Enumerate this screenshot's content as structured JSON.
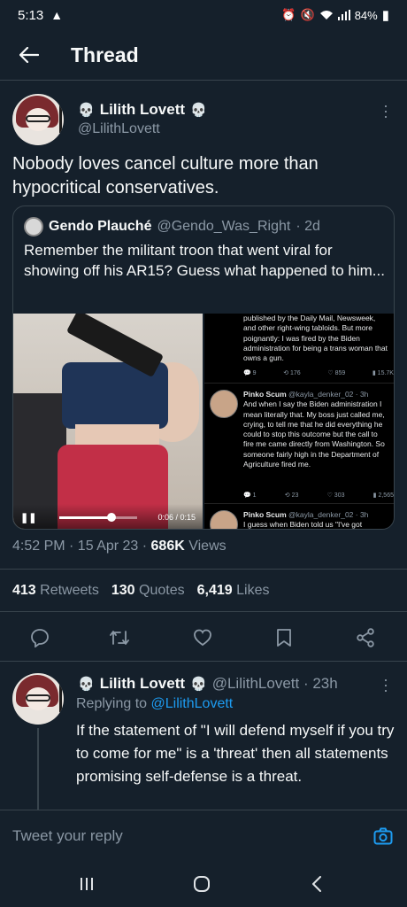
{
  "status_bar": {
    "time": "5:13",
    "warning_icon": "warning-triangle-icon",
    "battery": "84%"
  },
  "header": {
    "title": "Thread"
  },
  "main_tweet": {
    "author_name": "Lilith Lovett",
    "author_handle": "@LilithLovett",
    "name_decoration": "💀",
    "text": "Nobody loves cancel culture more than hypocritical conservatives.",
    "timestamp": "4:52 PM · 15 Apr 23 · ",
    "views_count": "686K",
    "views_label": " Views",
    "retweets_count": "413",
    "retweets_label": "Retweets",
    "quotes_count": "130",
    "quotes_label": "Quotes",
    "likes_count": "6,419",
    "likes_label": "Likes"
  },
  "quoted_tweet": {
    "author_name": "Gendo Plauché",
    "author_handle": "@Gendo_Was_Right",
    "time": "· 2d",
    "text": "Remember the militant troon that went viral for showing off his AR15? Guess what happened to him...",
    "video": {
      "time": "0:06 / 0:15",
      "progress": 0.67
    },
    "screenshot": {
      "top_text": "published by the Daily Mail, Newsweek, and other right-wing tabloids. But more poignantly: I was fired by the Biden administration for being a trans woman that owns a gun.",
      "top_stats": [
        "9",
        "176",
        "859",
        "15.7K"
      ],
      "reply1_name": "Pinko Scum",
      "reply1_handle": "@kayla_denker_02 · 3h",
      "reply1_text": "And when I say the Biden administration I mean literally that. My boss just called me, crying, to tell me that he did everything he could to stop this outcome but the call to fire me came directly from Washington. So someone fairly high in the Department of Agriculture fired me.",
      "reply1_stats": [
        "1",
        "23",
        "303",
        "2,565"
      ],
      "reply2_name": "Pinko Scum",
      "reply2_handle": "@kayla_denker_02 · 3h",
      "reply2_text": "I guess when Biden told us \"I've got"
    }
  },
  "reply": {
    "author_name": "Lilith Lovett",
    "author_handle": "@LilithLovett · 23h",
    "replying_prefix": "Replying to ",
    "replying_to": "@LilithLovett",
    "text": "If the statement of \"I will defend myself if you try to come for me\" is a 'threat' then all statements promising self-defense is a threat."
  },
  "compose": {
    "placeholder": "Tweet your reply"
  },
  "colors": {
    "background": "#15202b",
    "accent": "#1d9bf0",
    "secondary_text": "#8b98a5",
    "divider": "#38444d"
  }
}
